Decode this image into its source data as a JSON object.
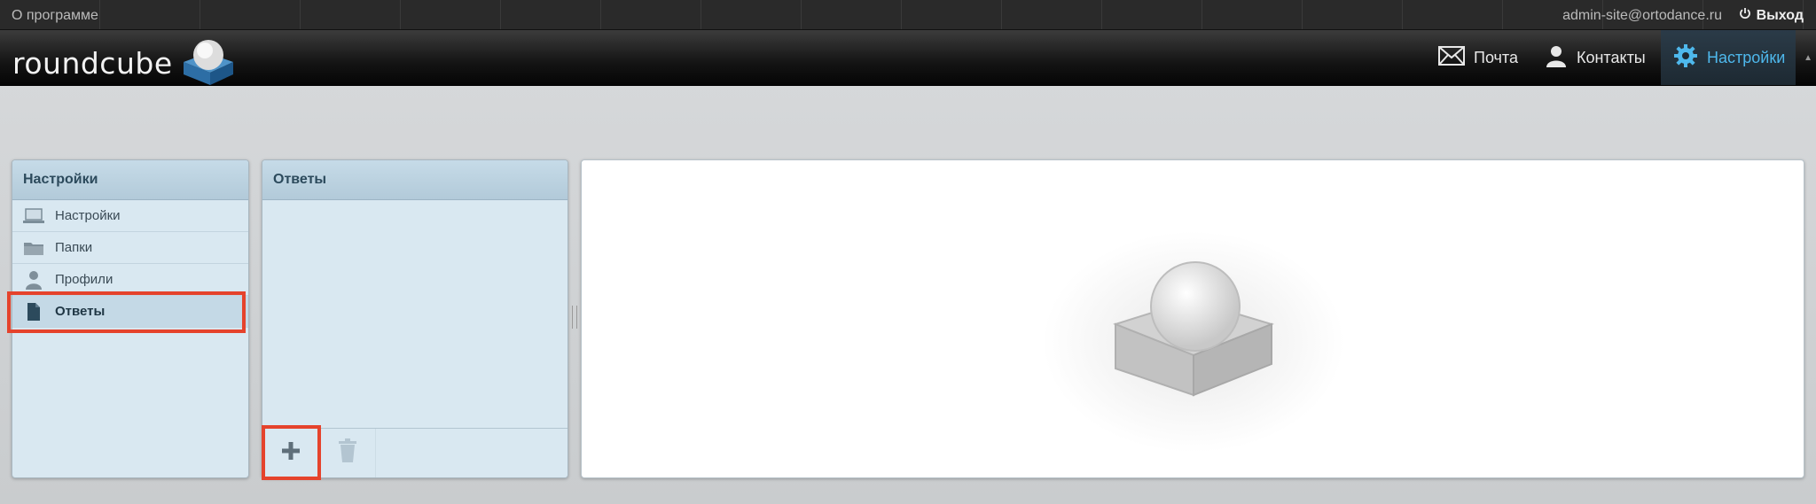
{
  "topline": {
    "about": "О программе",
    "user_email": "admin-site@ortodance.ru",
    "logout": "Выход"
  },
  "header": {
    "logo_text": "roundcube",
    "nav": {
      "mail": "Почта",
      "contacts": "Контакты",
      "settings": "Настройки"
    },
    "active_nav": "settings",
    "active_color": "#4eb8ec"
  },
  "settings_panel": {
    "title": "Настройки",
    "items": [
      {
        "label": "Настройки",
        "icon": "computer-icon"
      },
      {
        "label": "Папки",
        "icon": "folder-icon"
      },
      {
        "label": "Профили",
        "icon": "user-icon"
      },
      {
        "label": "Ответы",
        "icon": "document-icon",
        "selected": true
      }
    ]
  },
  "responses_panel": {
    "title": "Ответы",
    "add_button": "add-icon",
    "delete_button": "trash-icon"
  },
  "highlight_color": "#e5432c"
}
